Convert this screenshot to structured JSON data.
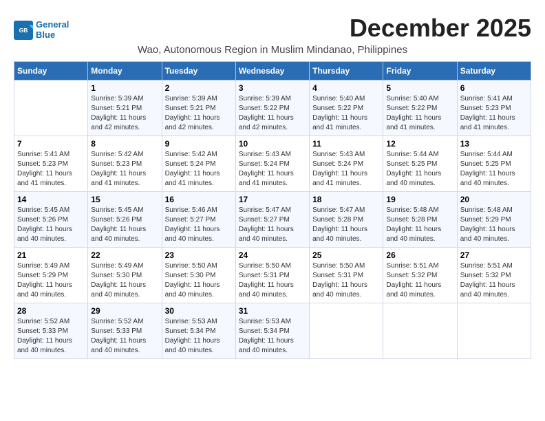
{
  "logo": {
    "line1": "General",
    "line2": "Blue"
  },
  "title": "December 2025",
  "subtitle": "Wao, Autonomous Region in Muslim Mindanao, Philippines",
  "days_of_week": [
    "Sunday",
    "Monday",
    "Tuesday",
    "Wednesday",
    "Thursday",
    "Friday",
    "Saturday"
  ],
  "weeks": [
    [
      {
        "day": "",
        "sunrise": "",
        "sunset": "",
        "daylight": ""
      },
      {
        "day": "1",
        "sunrise": "Sunrise: 5:39 AM",
        "sunset": "Sunset: 5:21 PM",
        "daylight": "Daylight: 11 hours and 42 minutes."
      },
      {
        "day": "2",
        "sunrise": "Sunrise: 5:39 AM",
        "sunset": "Sunset: 5:21 PM",
        "daylight": "Daylight: 11 hours and 42 minutes."
      },
      {
        "day": "3",
        "sunrise": "Sunrise: 5:39 AM",
        "sunset": "Sunset: 5:22 PM",
        "daylight": "Daylight: 11 hours and 42 minutes."
      },
      {
        "day": "4",
        "sunrise": "Sunrise: 5:40 AM",
        "sunset": "Sunset: 5:22 PM",
        "daylight": "Daylight: 11 hours and 41 minutes."
      },
      {
        "day": "5",
        "sunrise": "Sunrise: 5:40 AM",
        "sunset": "Sunset: 5:22 PM",
        "daylight": "Daylight: 11 hours and 41 minutes."
      },
      {
        "day": "6",
        "sunrise": "Sunrise: 5:41 AM",
        "sunset": "Sunset: 5:23 PM",
        "daylight": "Daylight: 11 hours and 41 minutes."
      }
    ],
    [
      {
        "day": "7",
        "sunrise": "Sunrise: 5:41 AM",
        "sunset": "Sunset: 5:23 PM",
        "daylight": "Daylight: 11 hours and 41 minutes."
      },
      {
        "day": "8",
        "sunrise": "Sunrise: 5:42 AM",
        "sunset": "Sunset: 5:23 PM",
        "daylight": "Daylight: 11 hours and 41 minutes."
      },
      {
        "day": "9",
        "sunrise": "Sunrise: 5:42 AM",
        "sunset": "Sunset: 5:24 PM",
        "daylight": "Daylight: 11 hours and 41 minutes."
      },
      {
        "day": "10",
        "sunrise": "Sunrise: 5:43 AM",
        "sunset": "Sunset: 5:24 PM",
        "daylight": "Daylight: 11 hours and 41 minutes."
      },
      {
        "day": "11",
        "sunrise": "Sunrise: 5:43 AM",
        "sunset": "Sunset: 5:24 PM",
        "daylight": "Daylight: 11 hours and 41 minutes."
      },
      {
        "day": "12",
        "sunrise": "Sunrise: 5:44 AM",
        "sunset": "Sunset: 5:25 PM",
        "daylight": "Daylight: 11 hours and 40 minutes."
      },
      {
        "day": "13",
        "sunrise": "Sunrise: 5:44 AM",
        "sunset": "Sunset: 5:25 PM",
        "daylight": "Daylight: 11 hours and 40 minutes."
      }
    ],
    [
      {
        "day": "14",
        "sunrise": "Sunrise: 5:45 AM",
        "sunset": "Sunset: 5:26 PM",
        "daylight": "Daylight: 11 hours and 40 minutes."
      },
      {
        "day": "15",
        "sunrise": "Sunrise: 5:45 AM",
        "sunset": "Sunset: 5:26 PM",
        "daylight": "Daylight: 11 hours and 40 minutes."
      },
      {
        "day": "16",
        "sunrise": "Sunrise: 5:46 AM",
        "sunset": "Sunset: 5:27 PM",
        "daylight": "Daylight: 11 hours and 40 minutes."
      },
      {
        "day": "17",
        "sunrise": "Sunrise: 5:47 AM",
        "sunset": "Sunset: 5:27 PM",
        "daylight": "Daylight: 11 hours and 40 minutes."
      },
      {
        "day": "18",
        "sunrise": "Sunrise: 5:47 AM",
        "sunset": "Sunset: 5:28 PM",
        "daylight": "Daylight: 11 hours and 40 minutes."
      },
      {
        "day": "19",
        "sunrise": "Sunrise: 5:48 AM",
        "sunset": "Sunset: 5:28 PM",
        "daylight": "Daylight: 11 hours and 40 minutes."
      },
      {
        "day": "20",
        "sunrise": "Sunrise: 5:48 AM",
        "sunset": "Sunset: 5:29 PM",
        "daylight": "Daylight: 11 hours and 40 minutes."
      }
    ],
    [
      {
        "day": "21",
        "sunrise": "Sunrise: 5:49 AM",
        "sunset": "Sunset: 5:29 PM",
        "daylight": "Daylight: 11 hours and 40 minutes."
      },
      {
        "day": "22",
        "sunrise": "Sunrise: 5:49 AM",
        "sunset": "Sunset: 5:30 PM",
        "daylight": "Daylight: 11 hours and 40 minutes."
      },
      {
        "day": "23",
        "sunrise": "Sunrise: 5:50 AM",
        "sunset": "Sunset: 5:30 PM",
        "daylight": "Daylight: 11 hours and 40 minutes."
      },
      {
        "day": "24",
        "sunrise": "Sunrise: 5:50 AM",
        "sunset": "Sunset: 5:31 PM",
        "daylight": "Daylight: 11 hours and 40 minutes."
      },
      {
        "day": "25",
        "sunrise": "Sunrise: 5:50 AM",
        "sunset": "Sunset: 5:31 PM",
        "daylight": "Daylight: 11 hours and 40 minutes."
      },
      {
        "day": "26",
        "sunrise": "Sunrise: 5:51 AM",
        "sunset": "Sunset: 5:32 PM",
        "daylight": "Daylight: 11 hours and 40 minutes."
      },
      {
        "day": "27",
        "sunrise": "Sunrise: 5:51 AM",
        "sunset": "Sunset: 5:32 PM",
        "daylight": "Daylight: 11 hours and 40 minutes."
      }
    ],
    [
      {
        "day": "28",
        "sunrise": "Sunrise: 5:52 AM",
        "sunset": "Sunset: 5:33 PM",
        "daylight": "Daylight: 11 hours and 40 minutes."
      },
      {
        "day": "29",
        "sunrise": "Sunrise: 5:52 AM",
        "sunset": "Sunset: 5:33 PM",
        "daylight": "Daylight: 11 hours and 40 minutes."
      },
      {
        "day": "30",
        "sunrise": "Sunrise: 5:53 AM",
        "sunset": "Sunset: 5:34 PM",
        "daylight": "Daylight: 11 hours and 40 minutes."
      },
      {
        "day": "31",
        "sunrise": "Sunrise: 5:53 AM",
        "sunset": "Sunset: 5:34 PM",
        "daylight": "Daylight: 11 hours and 40 minutes."
      },
      {
        "day": "",
        "sunrise": "",
        "sunset": "",
        "daylight": ""
      },
      {
        "day": "",
        "sunrise": "",
        "sunset": "",
        "daylight": ""
      },
      {
        "day": "",
        "sunrise": "",
        "sunset": "",
        "daylight": ""
      }
    ]
  ]
}
